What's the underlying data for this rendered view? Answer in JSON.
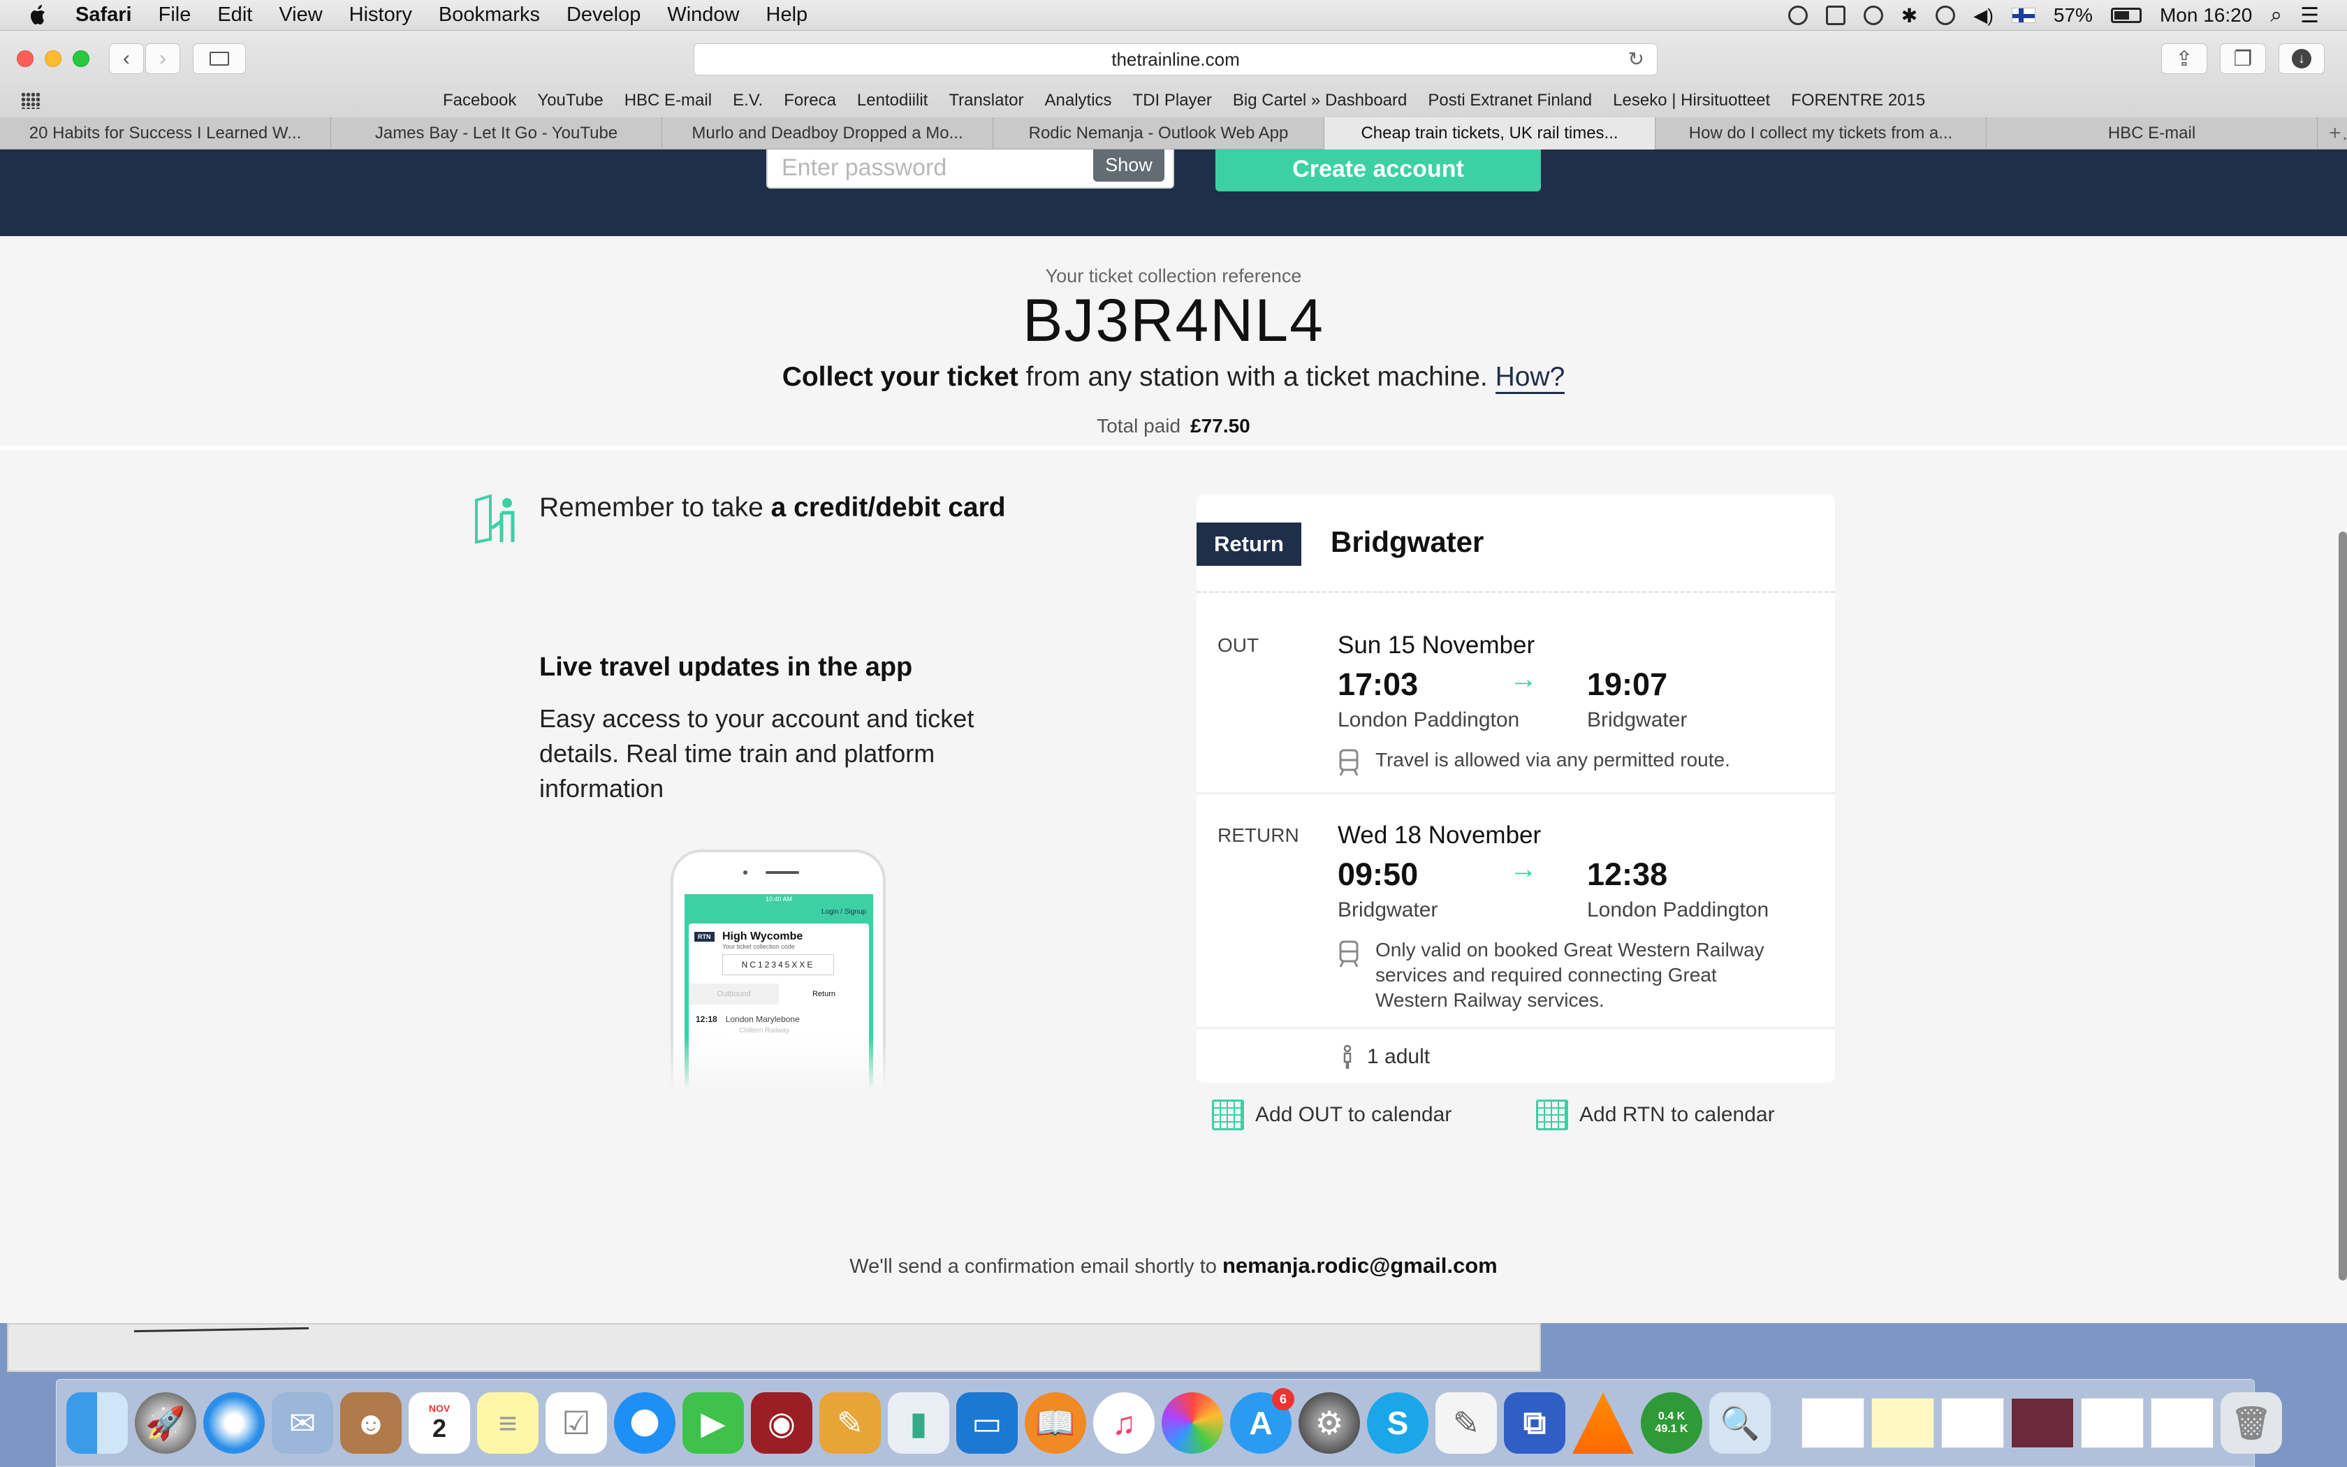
{
  "menubar": {
    "app": "Safari",
    "items": [
      "File",
      "Edit",
      "View",
      "History",
      "Bookmarks",
      "Develop",
      "Window",
      "Help"
    ],
    "battery": "57%",
    "clock": "Mon 16:20"
  },
  "browser": {
    "url": "thetrainline.com",
    "bookmarks": [
      "Facebook",
      "YouTube",
      "HBC E-mail",
      "E.V.",
      "Foreca",
      "Lentodiilit",
      "Translator",
      "Analytics",
      "TDI Player",
      "Big Cartel » Dashboard",
      "Posti Extranet Finland",
      "Leseko | Hirsituotteet",
      "FORENTRE 2015"
    ],
    "tabs": [
      "20 Habits for Success I Learned W...",
      "James Bay - Let It Go - YouTube",
      "Murlo and Deadboy Dropped a Mo...",
      "Rodic Nemanja - Outlook Web App",
      "Cheap train tickets, UK rail times...",
      "How do I collect my tickets from a...",
      "HBC E-mail"
    ],
    "active_tab": 4
  },
  "signup": {
    "password_placeholder": "Enter password",
    "show_label": "Show",
    "create_label": "Create account"
  },
  "reference": {
    "label": "Your ticket collection reference",
    "code": "BJ3R4NL4",
    "collect_bold": "Collect your ticket",
    "collect_rest": " from any station with a ticket machine. ",
    "how_link": "How?",
    "total_label": "Total paid",
    "total_value": "£77.50"
  },
  "tips": {
    "remember_prefix": "Remember to take ",
    "remember_bold": "a credit/debit card",
    "live_title": "Live travel updates in the app",
    "live_body": "Easy access to your account and ticket details. Real time train and platform information"
  },
  "phone": {
    "status": "10:40 AM",
    "login": "Login / Signup",
    "badge": "RTN",
    "dest": "High Wycombe",
    "sub": "Your ticket collection code",
    "code": "NC12345XXE",
    "tab_out": "Outbound",
    "tab_ret": "Return",
    "time": "12:18",
    "station": "London Marylebone",
    "op": "Chiltern Railway"
  },
  "ticket": {
    "type": "Return",
    "destination": "Bridgwater",
    "out": {
      "label": "OUT",
      "date": "Sun 15 November",
      "depart_time": "17:03",
      "arrive_time": "19:07",
      "depart_station": "London Paddington",
      "arrive_station": "Bridgwater",
      "note": "Travel is allowed via any permitted route."
    },
    "return": {
      "label": "RETURN",
      "date": "Wed 18 November",
      "depart_time": "09:50",
      "arrive_time": "12:38",
      "depart_station": "Bridgwater",
      "arrive_station": "London Paddington",
      "note": "Only valid on booked Great Western Railway services and required connecting Great Western Railway services."
    },
    "passengers": "1 adult"
  },
  "calendar": {
    "out_label": "Add OUT to calendar",
    "rtn_label": "Add RTN to calendar"
  },
  "confirmation": {
    "text": "We'll send a confirmation email shortly to ",
    "email": "nemanja.rodic@gmail.com"
  },
  "dock": {
    "appstore_badge": "6",
    "net_up": "0.4 K",
    "net_down": "49.1 K",
    "calendar_month": "NOV",
    "calendar_day": "2"
  },
  "colors": {
    "navy": "#1f2f4a",
    "accent": "#3cd0a5"
  }
}
